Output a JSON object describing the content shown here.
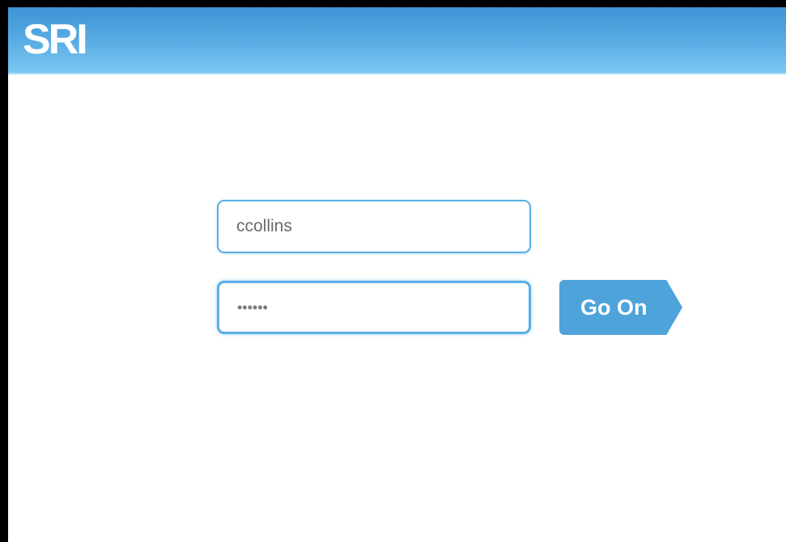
{
  "header": {
    "logo_text": "SRI",
    "brand_color": "#4fa3db"
  },
  "login": {
    "username_value": "ccollins",
    "password_value": "••••••",
    "submit_label": "Go On"
  }
}
